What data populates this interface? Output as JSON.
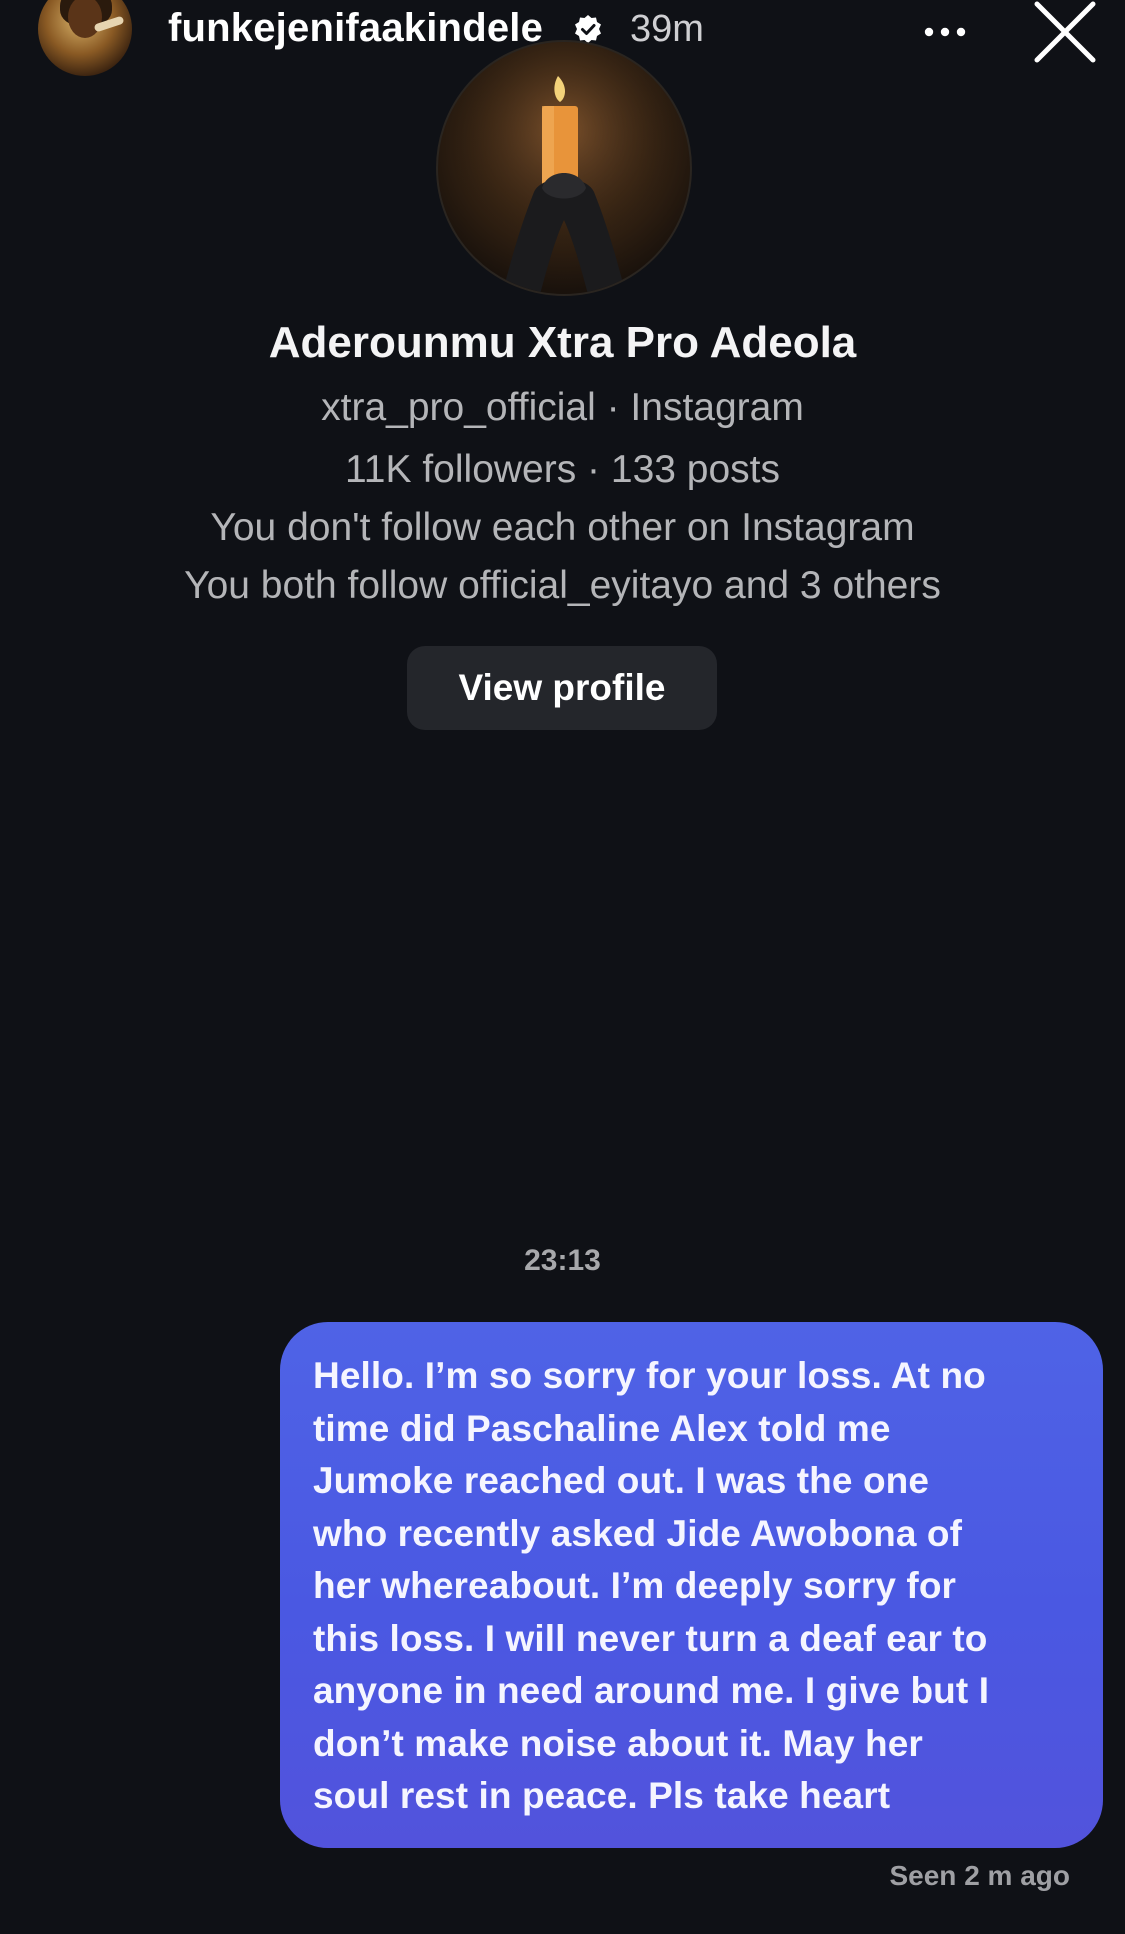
{
  "story": {
    "username": "funkejenifaakindele",
    "time": "39m"
  },
  "profile": {
    "name": "Aderounmu Xtra Pro Adeola",
    "handle_line": "xtra_pro_official · Instagram",
    "stats_line": "11K followers · 133 posts",
    "follow_status": "You don't follow each other on Instagram",
    "mutual_line": "You both follow official_eyitayo and 3 others",
    "view_profile_label": "View profile"
  },
  "conversation": {
    "timestamp": "23:13",
    "messages": [
      {
        "sender": "me",
        "lines": [
          "Hello. I’m so sorry for your loss. At no",
          "time did Paschaline Alex told me",
          "Jumoke reached out. I was the one",
          "who recently asked Jide Awobona of",
          "her whereabout. I’m deeply sorry for",
          "this loss. I will never turn a deaf ear to",
          "anyone in need around me. I give but I",
          "don’t make noise about it. May her",
          "soul rest in peace. Pls take heart"
        ]
      }
    ],
    "seen_status": "Seen 2 m ago"
  },
  "icons": {
    "verified": "verified-badge-icon",
    "more": "more-options-icon",
    "close": "close-icon"
  },
  "colors": {
    "background": "#0f1116",
    "bubble": "#4f63e6",
    "button": "#24262b"
  }
}
